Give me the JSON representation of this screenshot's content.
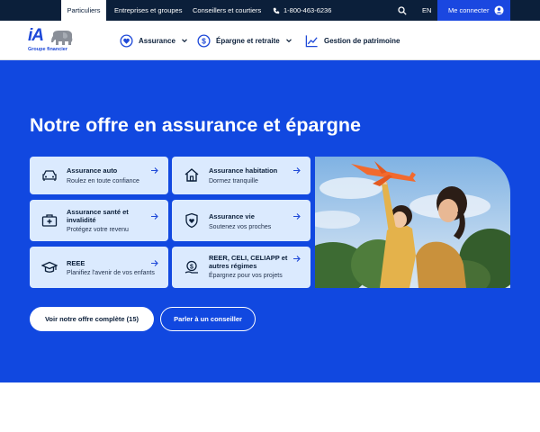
{
  "topbar": {
    "tabs": [
      "Particuliers",
      "Entreprises et groupes",
      "Conseillers et courtiers"
    ],
    "phone": "1-800-463-6236",
    "lang": "EN",
    "login_label": "Me connecter"
  },
  "brand": {
    "logo_text": "iA",
    "logo_subtitle": "Groupe financier"
  },
  "nav": {
    "items": [
      "Assurance",
      "Épargne et retraite",
      "Gestion de patrimoine"
    ]
  },
  "hero": {
    "title": "Notre offre en assurance et épargne",
    "cards": [
      {
        "title": "Assurance auto",
        "subtitle": "Roulez en toute confiance"
      },
      {
        "title": "Assurance habitation",
        "subtitle": "Dormez tranquille"
      },
      {
        "title": "Assurance santé et invalidité",
        "subtitle": "Protégez votre revenu"
      },
      {
        "title": "Assurance vie",
        "subtitle": "Soutenez vos proches"
      },
      {
        "title": "REEE",
        "subtitle": "Planifiez l'avenir de vos enfants"
      },
      {
        "title": "REER, CELI, CELIAPP et autres régimes",
        "subtitle": "Épargnez pour vos projets"
      }
    ],
    "primary_button": "Voir notre offre complète (15)",
    "secondary_button": "Parler à un conseiller"
  },
  "colors": {
    "hero_bg": "#1148e0",
    "topbar_bg": "#0b1f3a",
    "card_bg": "#dbeafe",
    "accent": "#1e49d8"
  }
}
